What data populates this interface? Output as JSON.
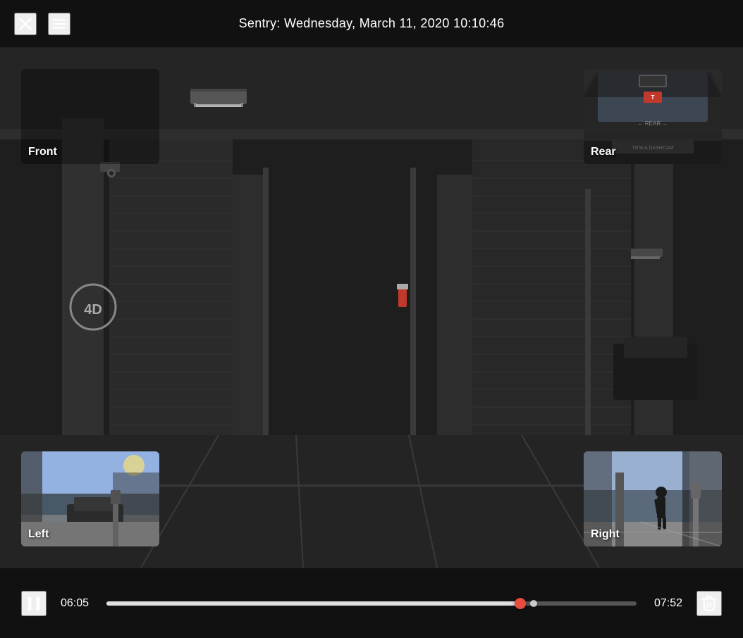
{
  "header": {
    "title": "Sentry: Wednesday, March 11, 2020 10:10:46",
    "close_icon": "close-icon",
    "menu_icon": "menu-icon"
  },
  "cameras": {
    "front": {
      "label": "Front",
      "position": "top-left"
    },
    "rear": {
      "label": "Rear",
      "position": "top-right"
    },
    "left": {
      "label": "Left",
      "position": "bottom-left"
    },
    "right": {
      "label": "Right",
      "position": "bottom-right"
    }
  },
  "controls": {
    "play_pause_state": "playing",
    "current_time": "06:05",
    "total_time": "07:52",
    "progress_percent": 78,
    "delete_icon": "trash-icon"
  }
}
